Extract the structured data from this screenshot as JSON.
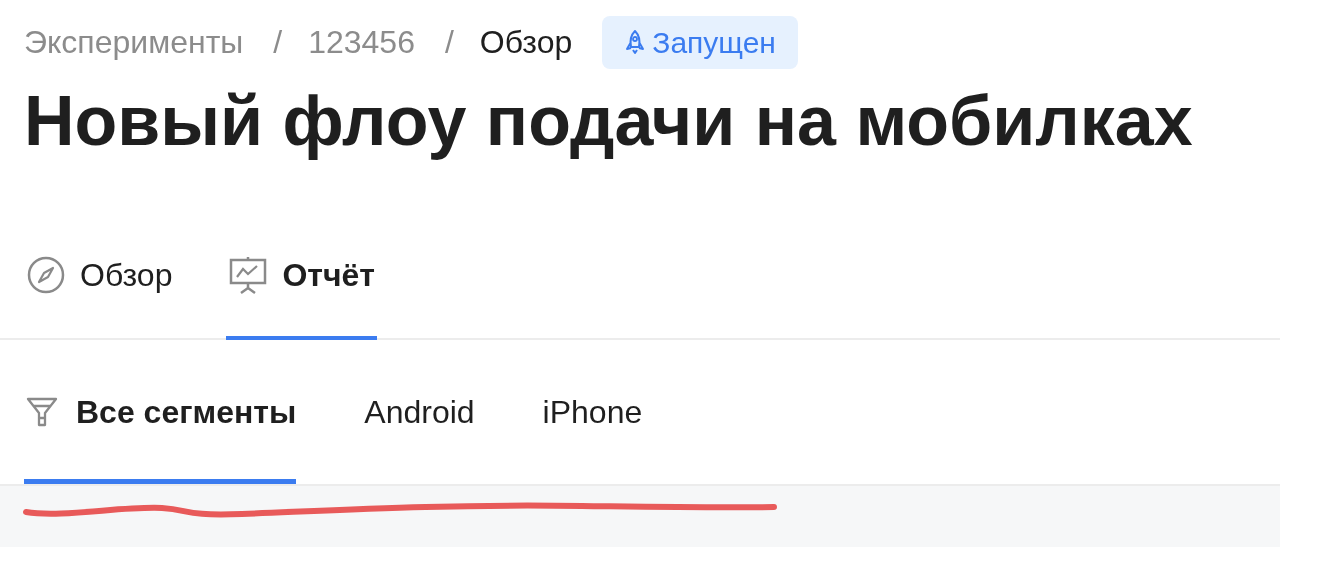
{
  "breadcrumb": [
    {
      "kind": "link",
      "label": "Эксперименты",
      "current": false
    },
    {
      "kind": "separator",
      "label": "/"
    },
    {
      "kind": "link",
      "label": "123456",
      "current": false
    },
    {
      "kind": "separator",
      "label": "/"
    },
    {
      "kind": "link",
      "label": "Обзор",
      "current": true
    }
  ],
  "status_badge": {
    "label": "Запущен"
  },
  "title": "Новый флоу подачи на мобилках",
  "tabs": [
    {
      "label": "Обзор",
      "selected": false
    },
    {
      "label": "Отчёт",
      "selected": true
    }
  ],
  "segments": [
    {
      "label": "Все сегменты",
      "selected": true
    },
    {
      "label": "Android",
      "selected": false
    },
    {
      "label": "iPhone",
      "selected": false
    }
  ],
  "annotation": {
    "kind": "underline-stroke",
    "color": "#e85a5a"
  }
}
